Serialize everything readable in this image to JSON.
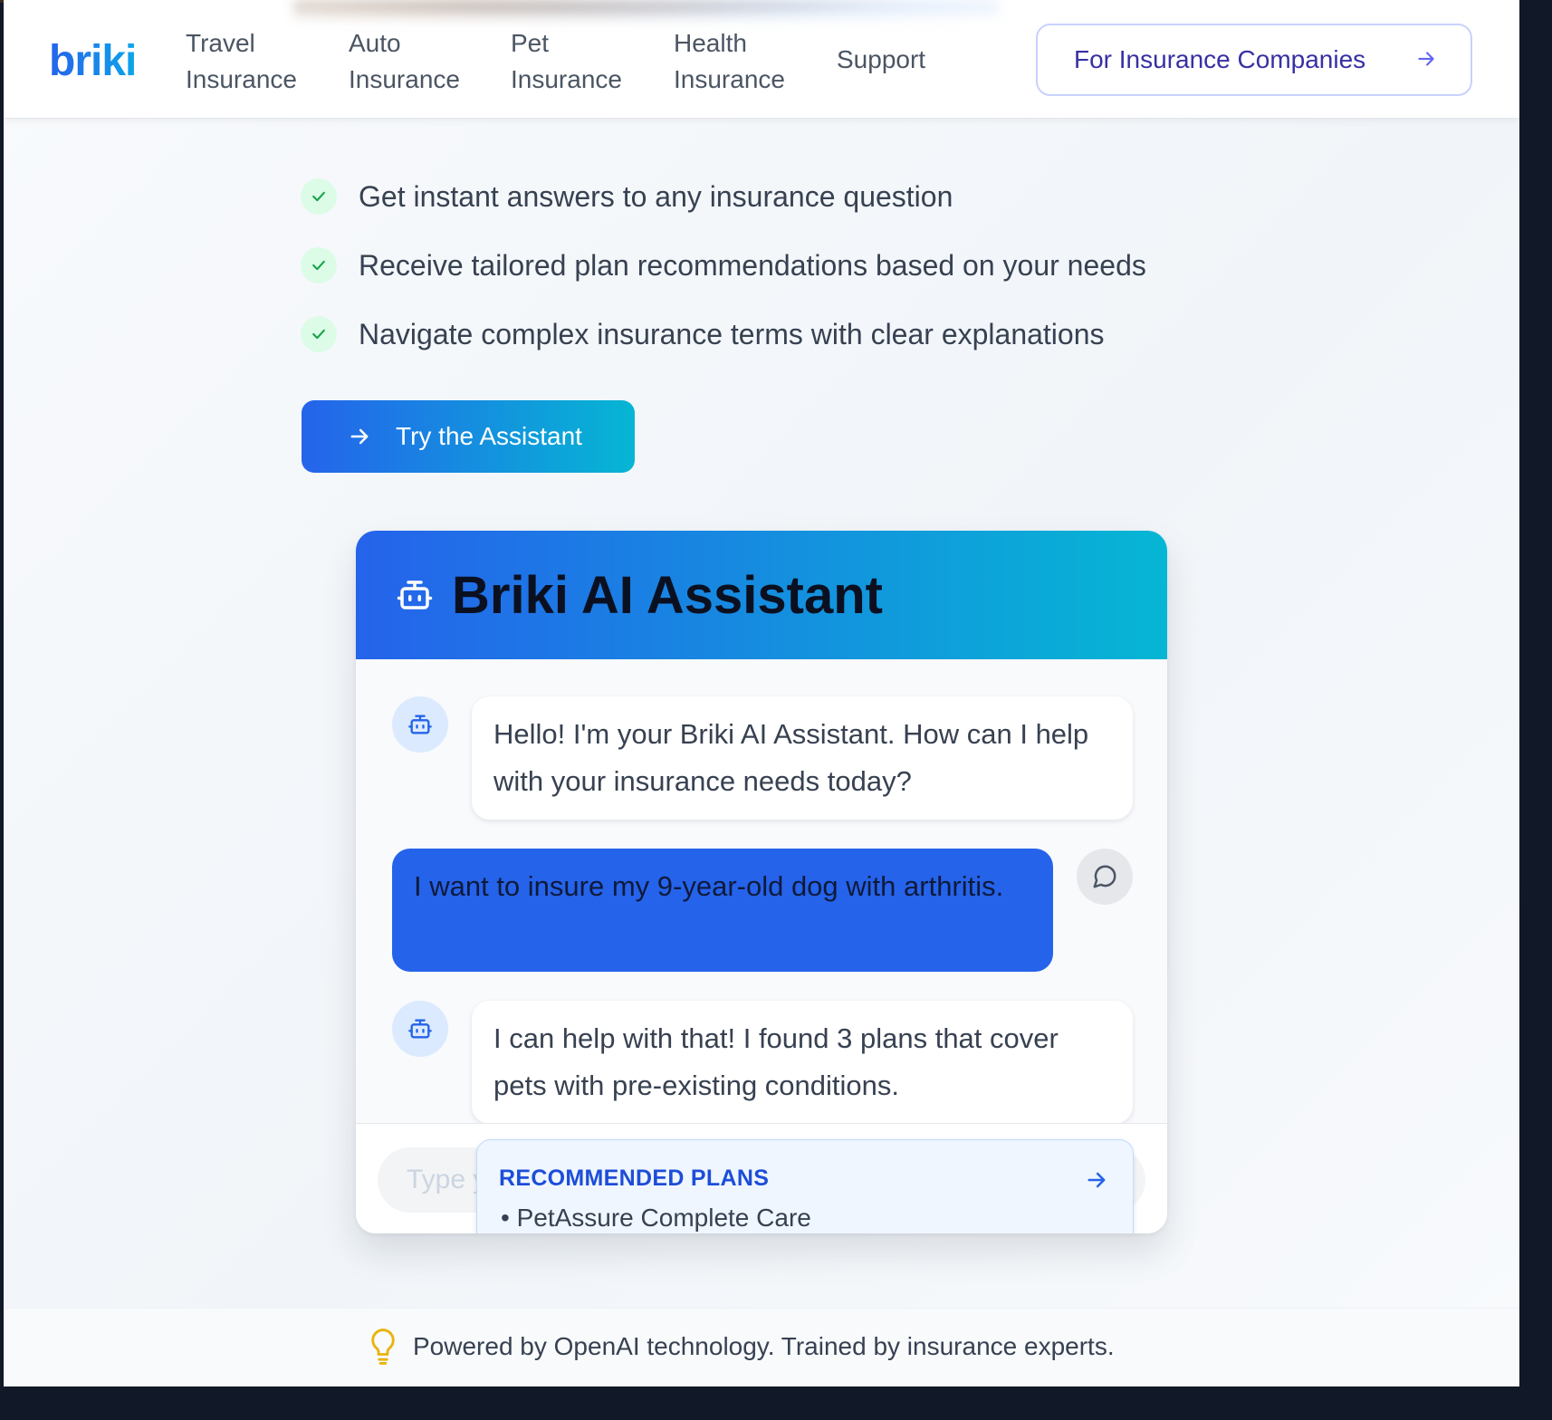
{
  "brand": {
    "logo_text": "briki"
  },
  "nav": {
    "items": [
      {
        "line1": "Travel",
        "line2": "Insurance"
      },
      {
        "line1": "Auto",
        "line2": "Insurance"
      },
      {
        "line1": "Pet",
        "line2": "Insurance"
      },
      {
        "line1": "Health",
        "line2": "Insurance"
      }
    ],
    "support": "Support",
    "companies_cta": "For Insurance Companies"
  },
  "features": [
    "Get instant answers to any insurance question",
    "Receive tailored plan recommendations based on your needs",
    "Navigate complex insurance terms with clear explanations"
  ],
  "try_button": "Try the Assistant",
  "chat": {
    "title": "Briki AI Assistant",
    "messages": [
      {
        "from": "bot",
        "text": "Hello! I'm your Briki AI Assistant. How can I help with your insurance needs today?"
      },
      {
        "from": "user",
        "text": "I want to insure my 9-year-old dog with arthritis."
      },
      {
        "from": "bot",
        "text": "I can help with that! I found 3 plans that cover pets with pre-existing conditions."
      }
    ],
    "input_placeholder": "Type your question...",
    "recommended": {
      "title": "RECOMMENDED PLANS",
      "items": [
        "• PetAssure Complete Care"
      ]
    }
  },
  "footer_note": "Powered by OpenAI technology. Trained by insurance experts.",
  "colors": {
    "primary": "#2563eb",
    "accent": "#06b6d4",
    "check_bg": "#dcfce7",
    "check": "#16a34a",
    "bulb": "#eab308"
  },
  "icons": {
    "check": "check-icon",
    "arrow": "arrow-right-icon",
    "bot": "bot-icon",
    "chat": "message-circle-icon",
    "bulb": "lightbulb-icon"
  }
}
